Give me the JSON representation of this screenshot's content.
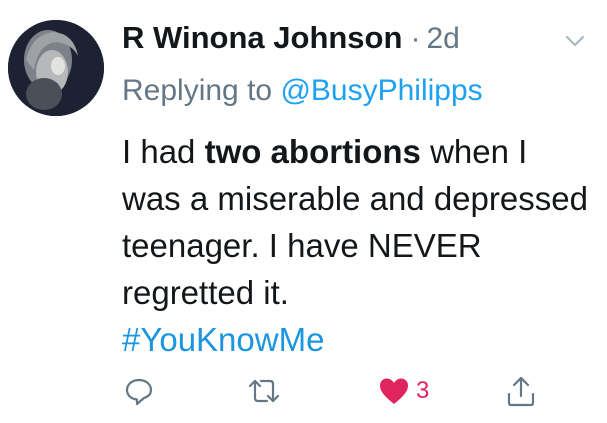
{
  "tweet": {
    "author_name": "R Winona Johnson",
    "separator": "·",
    "time_ago": "2d",
    "replying_prefix": "Replying to",
    "replying_handle": "@BusyPhilipps",
    "text_part1": "I had",
    "text_bold": "two abortions",
    "text_part2": "when I was a miserable and depressed teenager. I have NEVER regretted it.",
    "hashtag": "#YouKnowMe"
  },
  "actions": {
    "reply_icon": "reply-icon",
    "retweet_icon": "retweet-icon",
    "like_icon": "heart-icon",
    "like_count": "3",
    "share_icon": "share-icon"
  },
  "colors": {
    "text": "#14171a",
    "muted": "#657786",
    "link": "#1da1f2",
    "like": "#e0245e"
  }
}
